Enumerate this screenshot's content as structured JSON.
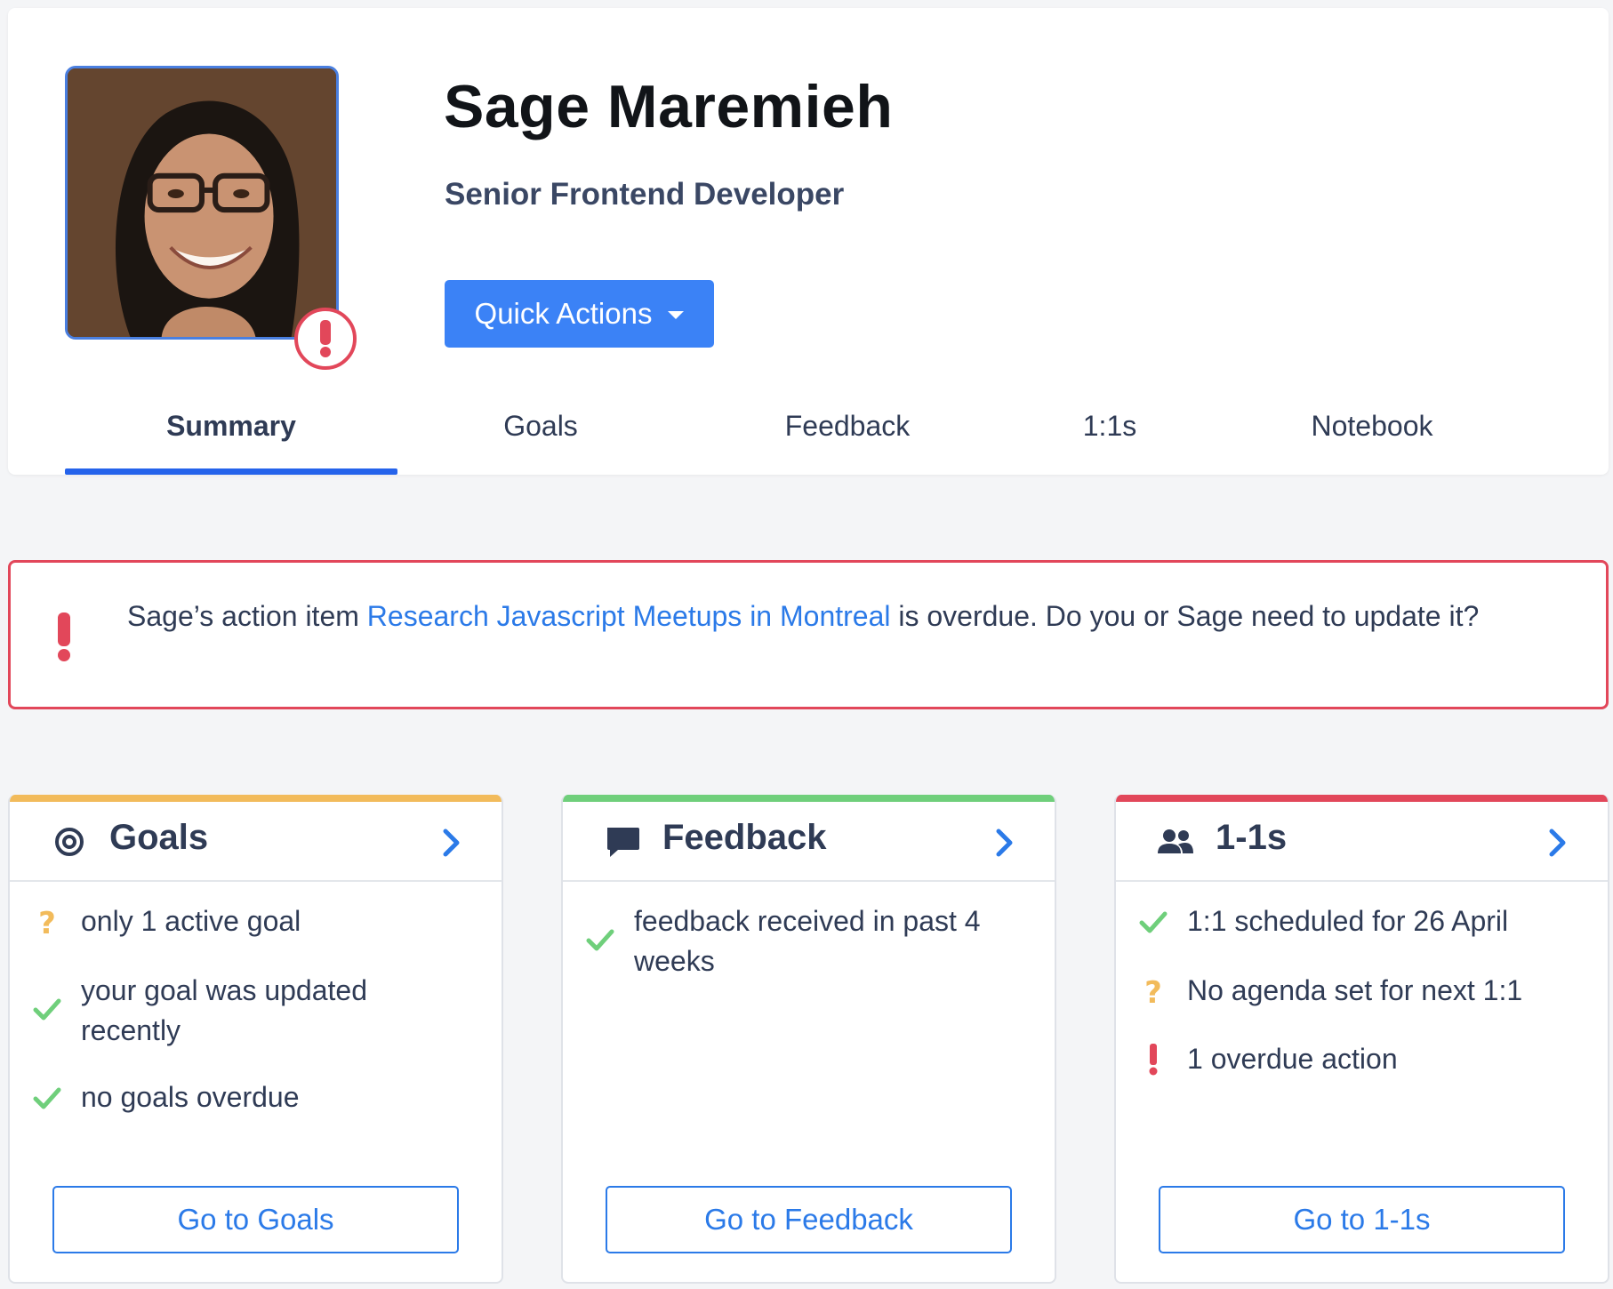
{
  "profile": {
    "name": "Sage Maremieh",
    "role": "Senior Frontend Developer",
    "quick_actions_label": "Quick Actions"
  },
  "tabs": [
    {
      "label": "Summary",
      "active": true
    },
    {
      "label": "Goals",
      "active": false
    },
    {
      "label": "Feedback",
      "active": false
    },
    {
      "label": "1:1s",
      "active": false
    },
    {
      "label": "Notebook",
      "active": false
    }
  ],
  "alert": {
    "text_before": "Sage’s action item ",
    "link_text": "Research Javascript Meetups in Montreal",
    "text_after": " is overdue. Do you or Sage need to update it?",
    "icon": "exclamation-icon"
  },
  "cards": [
    {
      "title": "Goals",
      "icon": "target-icon",
      "accent": "#f2bb5b",
      "items": [
        {
          "status": "question",
          "text": "only 1 active goal"
        },
        {
          "status": "check",
          "text": "your goal was updated recently"
        },
        {
          "status": "check",
          "text": "no goals overdue"
        }
      ],
      "button_label": "Go to Goals"
    },
    {
      "title": "Feedback",
      "icon": "speech-bubble-icon",
      "accent": "#6fcf7b",
      "items": [
        {
          "status": "check",
          "text": "feedback received in past 4 weeks"
        }
      ],
      "button_label": "Go to Feedback"
    },
    {
      "title": "1-1s",
      "icon": "people-icon",
      "accent": "#e2475a",
      "items": [
        {
          "status": "check",
          "text": "1:1 scheduled for 26 April"
        },
        {
          "status": "question",
          "text": "No agenda set for next 1:1"
        },
        {
          "status": "exclamation",
          "text": "1 overdue action"
        }
      ],
      "button_label": "Go to 1-1s"
    }
  ],
  "colors": {
    "primary": "#3b82f6",
    "link": "#2b7ae8",
    "danger": "#e2475a",
    "warning": "#f2bb5b",
    "success": "#6fcf7b"
  }
}
